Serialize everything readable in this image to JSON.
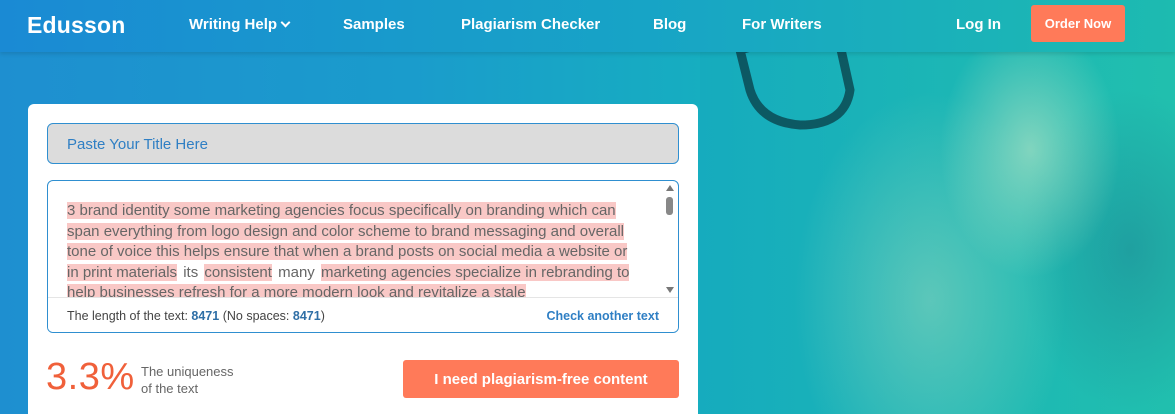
{
  "nav": {
    "logo": "Edusson",
    "items": [
      "Writing Help",
      "Samples",
      "Plagiarism Checker",
      "Blog",
      "For Writers"
    ],
    "login": "Log In",
    "order": "Order Now"
  },
  "checker": {
    "title_placeholder": "Paste Your Title Here",
    "text_seg_1": "3 brand identity some marketing agencies focus specifically on branding which can span everything from logo design and color scheme to brand messaging and overall tone of voice this helps ensure that when a brand posts on social media a website or in print materials",
    "word_its": "its",
    "word_consistent": "consistent",
    "word_many": "many",
    "text_seg_2": "marketing agencies specialize in rebranding to help businesses refresh for a more modern look and revitalize a stale",
    "length_label": "The length of the text:",
    "length_value": "8471",
    "nospace_open": "(No spaces:",
    "nospace_value": "8471",
    "nospace_close": ")",
    "check_another": "Check another text",
    "uniqueness_value": "3.3%",
    "uniqueness_line1": "The uniqueness",
    "uniqueness_line2": "of the text",
    "cta": "I need plagiarism-free content"
  },
  "colors": {
    "accent": "#ff7a59",
    "link": "#2f7fc4",
    "highlight": "#f9c8c6",
    "percent": "#f0603a"
  }
}
